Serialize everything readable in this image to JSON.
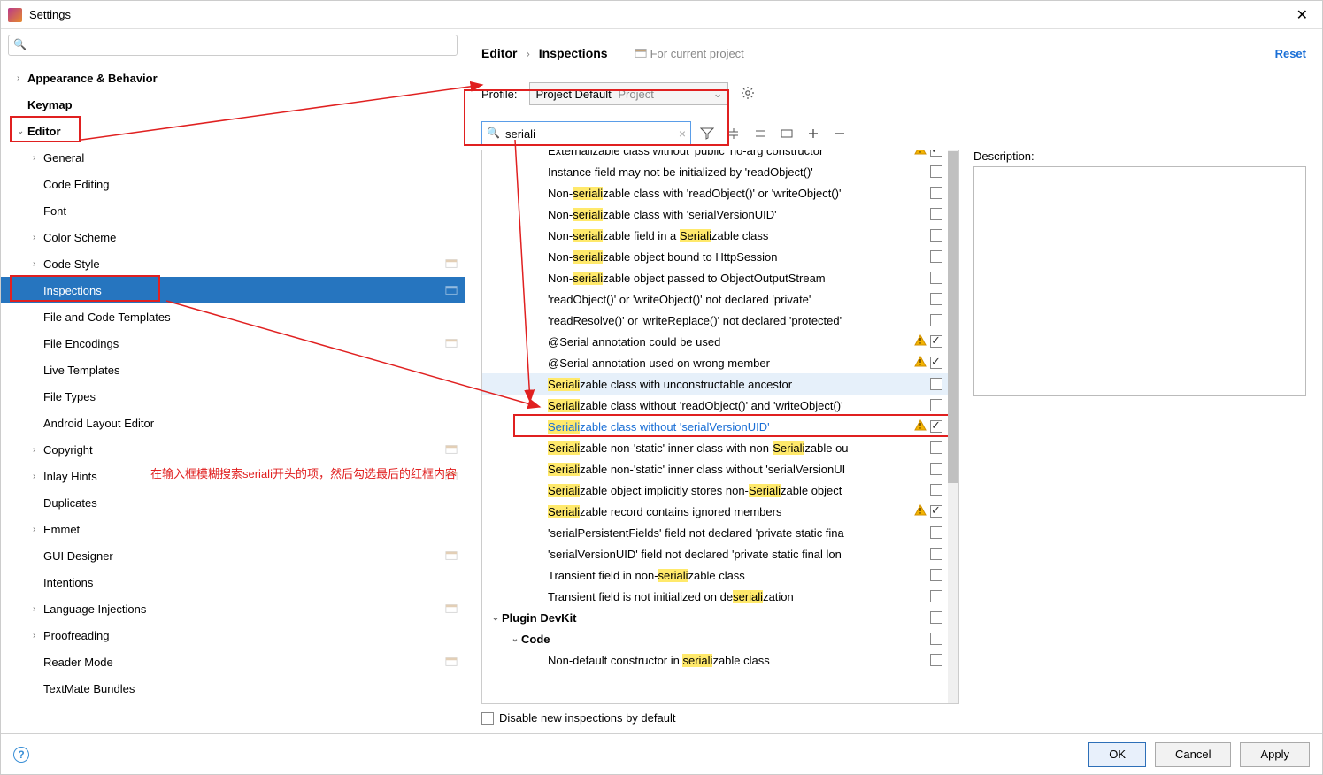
{
  "window": {
    "title": "Settings"
  },
  "sidebar": {
    "search_placeholder": "",
    "items": [
      {
        "label": "Appearance & Behavior",
        "bold": true,
        "arrow": "›",
        "depth": 0
      },
      {
        "label": "Keymap",
        "bold": true,
        "arrow": "",
        "depth": 0
      },
      {
        "label": "Editor",
        "bold": true,
        "arrow": "⌄",
        "depth": 0,
        "redbox": true
      },
      {
        "label": "General",
        "arrow": "›",
        "depth": 1
      },
      {
        "label": "Code Editing",
        "arrow": "",
        "depth": 1
      },
      {
        "label": "Font",
        "arrow": "",
        "depth": 1
      },
      {
        "label": "Color Scheme",
        "arrow": "›",
        "depth": 1
      },
      {
        "label": "Code Style",
        "arrow": "›",
        "depth": 1,
        "proj": true
      },
      {
        "label": "Inspections",
        "arrow": "",
        "depth": 1,
        "proj": true,
        "selected": true,
        "redbox": true
      },
      {
        "label": "File and Code Templates",
        "arrow": "",
        "depth": 1
      },
      {
        "label": "File Encodings",
        "arrow": "",
        "depth": 1,
        "proj": true
      },
      {
        "label": "Live Templates",
        "arrow": "",
        "depth": 1
      },
      {
        "label": "File Types",
        "arrow": "",
        "depth": 1
      },
      {
        "label": "Android Layout Editor",
        "arrow": "",
        "depth": 1
      },
      {
        "label": "Copyright",
        "arrow": "›",
        "depth": 1,
        "proj": true
      },
      {
        "label": "Inlay Hints",
        "arrow": "›",
        "depth": 1,
        "proj": true
      },
      {
        "label": "Duplicates",
        "arrow": "",
        "depth": 1
      },
      {
        "label": "Emmet",
        "arrow": "›",
        "depth": 1
      },
      {
        "label": "GUI Designer",
        "arrow": "",
        "depth": 1,
        "proj": true
      },
      {
        "label": "Intentions",
        "arrow": "",
        "depth": 1
      },
      {
        "label": "Language Injections",
        "arrow": "›",
        "depth": 1,
        "proj": true
      },
      {
        "label": "Proofreading",
        "arrow": "›",
        "depth": 1
      },
      {
        "label": "Reader Mode",
        "arrow": "",
        "depth": 1,
        "proj": true
      },
      {
        "label": "TextMate Bundles",
        "arrow": "",
        "depth": 1
      }
    ]
  },
  "breadcrumb": {
    "root": "Editor",
    "current": "Inspections",
    "proj_label": "For current project",
    "reset": "Reset"
  },
  "profile": {
    "label": "Profile:",
    "value": "Project Default",
    "suffix": "Project"
  },
  "search": {
    "value": "seriali"
  },
  "inspections": [
    {
      "indent": 3,
      "pre": "Externalizable class without 'public' no-arg constructor",
      "warn": true,
      "checked": true,
      "cut": true
    },
    {
      "indent": 3,
      "pre": "Instance field may not be initialized by 'readObject()'",
      "checked": false
    },
    {
      "indent": 3,
      "pre": "Non-",
      "hl": "seriali",
      "post": "zable class with 'readObject()' or 'writeObject()'",
      "checked": false
    },
    {
      "indent": 3,
      "pre": "Non-",
      "hl": "seriali",
      "post": "zable class with 'serialVersionUID'",
      "checked": false
    },
    {
      "indent": 3,
      "pre": "Non-",
      "hl": "seriali",
      "post": "zable field in a ",
      "hl2": "Seriali",
      "post2": "zable class",
      "checked": false
    },
    {
      "indent": 3,
      "pre": "Non-",
      "hl": "seriali",
      "post": "zable object bound to HttpSession",
      "checked": false
    },
    {
      "indent": 3,
      "pre": "Non-",
      "hl": "seriali",
      "post": "zable object passed to ObjectOutputStream",
      "checked": false
    },
    {
      "indent": 3,
      "pre": "'readObject()' or 'writeObject()' not declared 'private'",
      "checked": false
    },
    {
      "indent": 3,
      "pre": "'readResolve()' or 'writeReplace()' not declared 'protected'",
      "checked": false,
      "ellipsis": true
    },
    {
      "indent": 3,
      "pre": "@Serial annotation could be used",
      "warn": true,
      "checked": true
    },
    {
      "indent": 3,
      "pre": "@Serial annotation used on wrong member",
      "warn": true,
      "checked": true
    },
    {
      "indent": 3,
      "hl": "Seriali",
      "post": "zable class with unconstructable ancestor",
      "checked": false,
      "sel": true
    },
    {
      "indent": 3,
      "hl": "Seriali",
      "post": "zable class without 'readObject()' and 'writeObject()'",
      "checked": false
    },
    {
      "indent": 3,
      "hl": "Seriali",
      "post": "zable class without 'serialVersionUID'",
      "warn": true,
      "checked": true,
      "cursor": true,
      "redbox": true
    },
    {
      "indent": 3,
      "hl": "Seriali",
      "post": "zable non-'static' inner class with non-",
      "hl2": "Seriali",
      "post2": "zable ou",
      "checked": false,
      "ellipsis": true
    },
    {
      "indent": 3,
      "hl": "Seriali",
      "post": "zable non-'static' inner class without 'serialVersionUI",
      "checked": false,
      "ellipsis": true
    },
    {
      "indent": 3,
      "hl": "Seriali",
      "post": "zable object implicitly stores non-",
      "hl2": "Seriali",
      "post2": "zable object",
      "checked": false,
      "ellipsis": true
    },
    {
      "indent": 3,
      "hl": "Seriali",
      "post": "zable record contains ignored members",
      "warn": true,
      "checked": true
    },
    {
      "indent": 3,
      "pre": "'serialPersistentFields' field not declared 'private static fina",
      "checked": false,
      "ellipsis": true
    },
    {
      "indent": 3,
      "pre": "'serialVersionUID' field not declared 'private static final lon",
      "checked": false,
      "ellipsis": true
    },
    {
      "indent": 3,
      "pre": "Transient field in non-",
      "hl": "seriali",
      "post": "zable class",
      "checked": false
    },
    {
      "indent": 3,
      "pre": "Transient field is not initialized on de",
      "hl": "seriali",
      "post": "zation",
      "checked": false
    },
    {
      "indent": 0,
      "group": true,
      "pre": "Plugin DevKit",
      "exp": "⌄",
      "checked": false
    },
    {
      "indent": 1,
      "group": true,
      "pre": "Code",
      "exp": "⌄",
      "checked": false
    },
    {
      "indent": 3,
      "pre": "Non-default constructor in ",
      "hl": "seriali",
      "post": "zable class",
      "checked": false
    }
  ],
  "disable_label": "Disable new inspections by default",
  "description_label": "Description:",
  "annotation": "在输入框模糊搜索seriali开头的项，然后勾选最后的红框内容",
  "buttons": {
    "ok": "OK",
    "cancel": "Cancel",
    "apply": "Apply"
  }
}
